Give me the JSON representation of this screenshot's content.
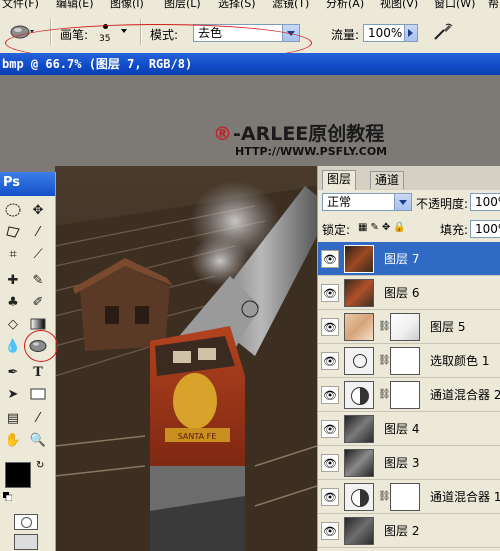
{
  "menubar": {
    "items": [
      "文件(F)",
      "编辑(E)",
      "图像(I)",
      "图层(L)",
      "选择(S)",
      "滤镜(T)",
      "分析(A)",
      "视图(V)",
      "窗口(W)",
      "帮"
    ]
  },
  "options": {
    "brush_label": "画笔:",
    "brush_size": "35",
    "mode_label": "模式:",
    "mode_value": "去色",
    "flow_label": "流量:",
    "flow_value": "100%"
  },
  "document": {
    "title": "bmp @ 66.7% (图层 7, RGB/8)"
  },
  "watermark": {
    "mark": "®",
    "text": "-ARLEE原创教程",
    "url": "HTTP://WWW.PSFLY.COM"
  },
  "toolbox": {
    "logo": "Ps"
  },
  "layers_panel": {
    "tabs": [
      "图层",
      "通道"
    ],
    "blend_mode": "正常",
    "opacity_label": "不透明度:",
    "opacity_value": "100%",
    "lock_label": "锁定:",
    "fill_label": "填充:",
    "fill_value": "100%",
    "layers": [
      {
        "name": "图层 7",
        "selected": true
      },
      {
        "name": "图层 6",
        "selected": false
      },
      {
        "name": "图层 5",
        "selected": false
      },
      {
        "name": "选取颜色 1",
        "selected": false
      },
      {
        "name": "通道混合器 2",
        "selected": false
      },
      {
        "name": "图层 4",
        "selected": false
      },
      {
        "name": "图层 3",
        "selected": false
      },
      {
        "name": "通道混合器 1",
        "selected": false
      },
      {
        "name": "图层 2",
        "selected": false
      }
    ]
  },
  "colors": {
    "title_bar": "#0f4bc7",
    "selected_layer": "#316ac5",
    "highlight_circle": "#d21a1a"
  }
}
